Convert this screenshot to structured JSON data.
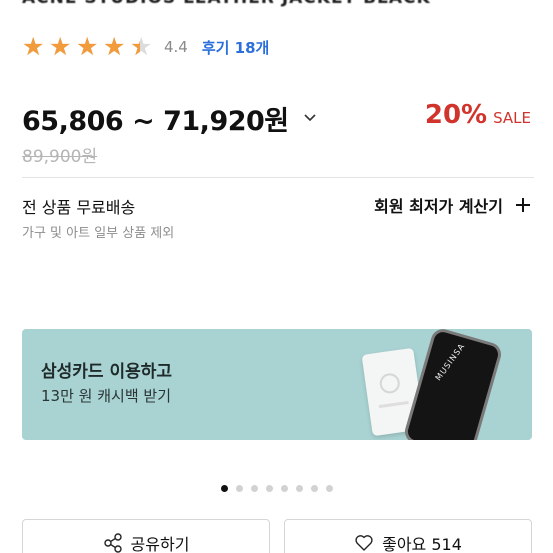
{
  "product": {
    "title": "ACNE STUDIOS LEATHER JACKET BLACK"
  },
  "rating": {
    "stars_filled": 4.4,
    "value": "4.4",
    "review_link": "후기 18개",
    "star_color": "#f29b3c"
  },
  "price": {
    "range": "65,806 ~ 71,920원",
    "discount_pct": "20%",
    "discount_label": "SALE",
    "original": "89,900원",
    "sale_color": "#d0342c"
  },
  "shipping": {
    "title": "전 상품 무료배송",
    "note": "가구 및 아트 일부 상품 제외"
  },
  "member": {
    "label": "회원 최저가 계산기"
  },
  "banner": {
    "title": "삼성카드 이용하고",
    "subtitle": "13만 원 캐시백 받기",
    "phone_text": "MUSINSA",
    "bg_color": "#a9d2d2"
  },
  "carousel": {
    "total": 8,
    "active": 1
  },
  "actions": {
    "share_label": "공유하기",
    "like_label": "좋아요 514"
  }
}
